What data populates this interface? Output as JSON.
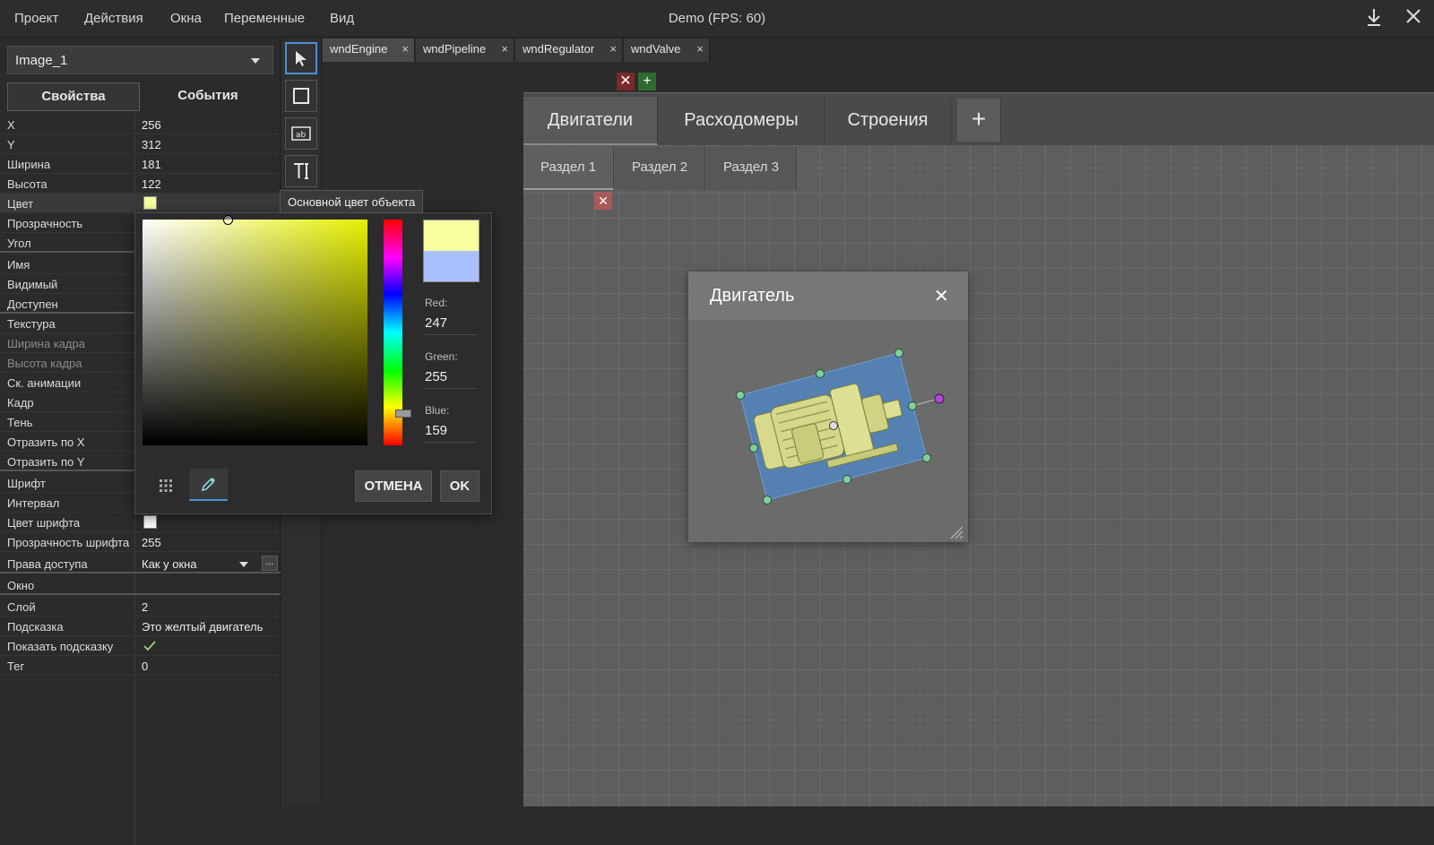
{
  "menubar": {
    "items": [
      "Проект",
      "Действия",
      "Окна",
      "Переменные",
      "Вид"
    ],
    "title": "Demo   (FPS: 60)",
    "download_icon": "download-icon",
    "close_icon": "close-icon"
  },
  "left_panel": {
    "object_select": "Image_1",
    "tabs": [
      "Свойства",
      "События"
    ],
    "properties": [
      {
        "label": "X",
        "value": "256"
      },
      {
        "label": "Y",
        "value": "312"
      },
      {
        "label": "Ширина",
        "value": "181"
      },
      {
        "label": "Высота",
        "value": "122"
      },
      {
        "label": "Цвет",
        "value": ""
      },
      {
        "label": "Прозрачность",
        "value": ""
      },
      {
        "label": "Угол",
        "value": ""
      },
      {
        "label": "Имя",
        "value": ""
      },
      {
        "label": "Видимый",
        "value": ""
      },
      {
        "label": "Доступен",
        "value": ""
      },
      {
        "label": "Текстура",
        "value": ""
      },
      {
        "label": "Ширина кадра",
        "value": ""
      },
      {
        "label": "Высота кадра",
        "value": ""
      },
      {
        "label": "Ск. анимации",
        "value": ""
      },
      {
        "label": "Кадр",
        "value": ""
      },
      {
        "label": "Тень",
        "value": ""
      },
      {
        "label": "Отразить по X",
        "value": ""
      },
      {
        "label": "Отразить по Y",
        "value": ""
      },
      {
        "label": "Шрифт",
        "value": ""
      },
      {
        "label": "Интервал",
        "value": ""
      },
      {
        "label": "Цвет шрифта",
        "value": ""
      },
      {
        "label": "Прозрачность шрифта",
        "value": "255"
      },
      {
        "label": "Права доступа",
        "value": "Как у окна"
      },
      {
        "label": "Окно",
        "value": ""
      },
      {
        "label": "Слой",
        "value": "2"
      },
      {
        "label": "Подсказка",
        "value": "Это желтый двигатель"
      },
      {
        "label": "Показать подсказку",
        "value": ""
      },
      {
        "label": "Тег",
        "value": "0"
      }
    ],
    "more_button": "...",
    "color_swatch": "#f7ff9f",
    "font_color_swatch": "#ffffff"
  },
  "toolbox": {
    "tools": [
      "pointer-tool",
      "rectangle-tool",
      "textbox-tool",
      "text-tool"
    ]
  },
  "window_tabs": [
    {
      "label": "wndEngine",
      "close": "×"
    },
    {
      "label": "wndPipeline",
      "close": "×"
    },
    {
      "label": "wndRegulator",
      "close": "×"
    },
    {
      "label": "wndValve",
      "close": "×"
    }
  ],
  "canvas": {
    "main_tabs": [
      "Двигатели",
      "Расходомеры",
      "Строения"
    ],
    "add_tab": "+",
    "sub_tabs": [
      "Раздел 1",
      "Раздел 2",
      "Раздел 3"
    ],
    "remove_button": "✕",
    "add_button": "+",
    "engine_window": {
      "title": "Двигатель",
      "close": "✕"
    }
  },
  "tooltip": "Основной цвет объекта",
  "color_picker": {
    "red_label": "Red:",
    "red": "247",
    "green_label": "Green:",
    "green": "255",
    "blue_label": "Blue:",
    "blue": "159",
    "new_color": "#f7ff9f",
    "old_color": "#a9c0ff",
    "cancel": "ОТМЕНА",
    "ok": "OK"
  }
}
